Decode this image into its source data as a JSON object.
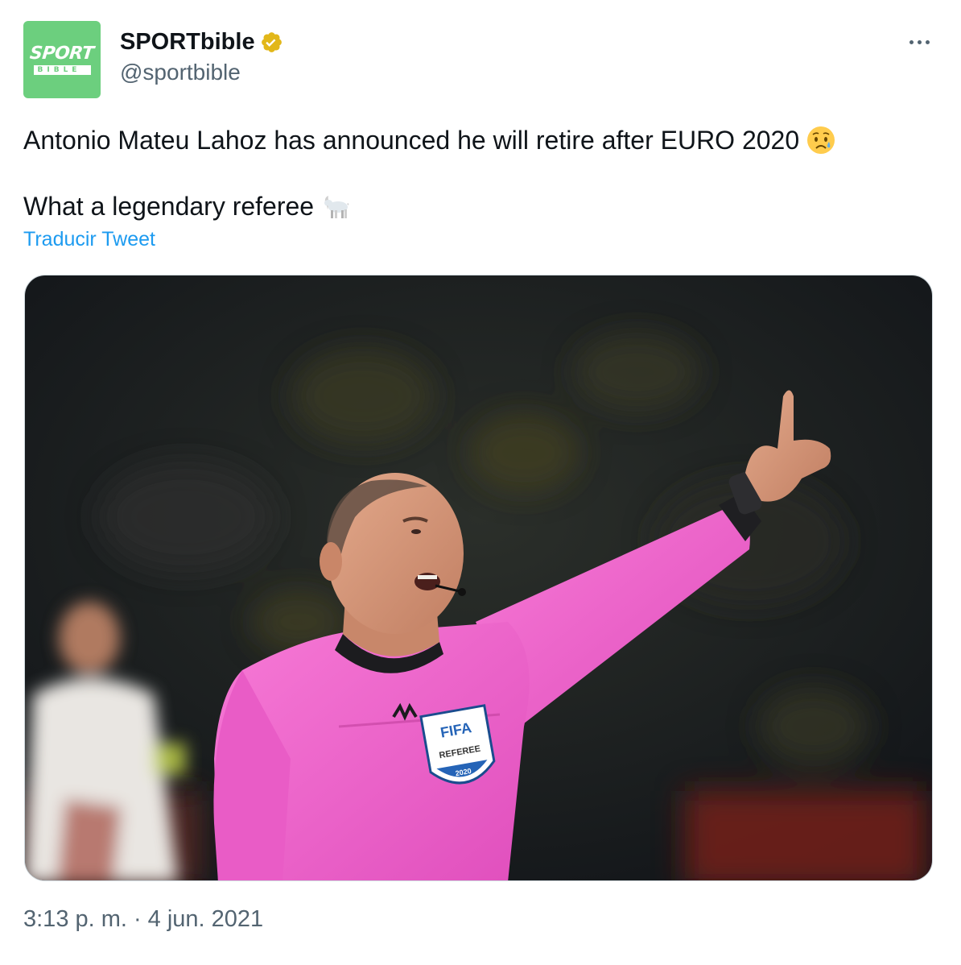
{
  "author": {
    "display_name": "SPORTbible",
    "handle": "@sportbible",
    "avatar_text_top": "SPORT",
    "avatar_text_bottom": "BIBLE",
    "avatar_color": "#6ccf7e",
    "verified": true,
    "verified_badge_color": "#e2b719"
  },
  "tweet": {
    "line1": "Antonio Mateu Lahoz has announced he will retire after EURO 2020",
    "line1_emoji": "sad-but-relieved-face-emoji",
    "line2": "What a legendary referee",
    "line2_emoji": "goat-emoji",
    "translate_label": "Traducir Tweet",
    "link_color": "#1d9bf0"
  },
  "media": {
    "badge_top": "FIFA",
    "badge_middle": "REFEREE",
    "badge_bottom": "2020",
    "shirt_color": "#f25fc8"
  },
  "meta": {
    "time": "3:13 p. m.",
    "separator": "·",
    "date": "4 jun. 2021"
  },
  "icons": {
    "more": "more-horizontal-icon",
    "verified": "verified-badge-icon"
  }
}
